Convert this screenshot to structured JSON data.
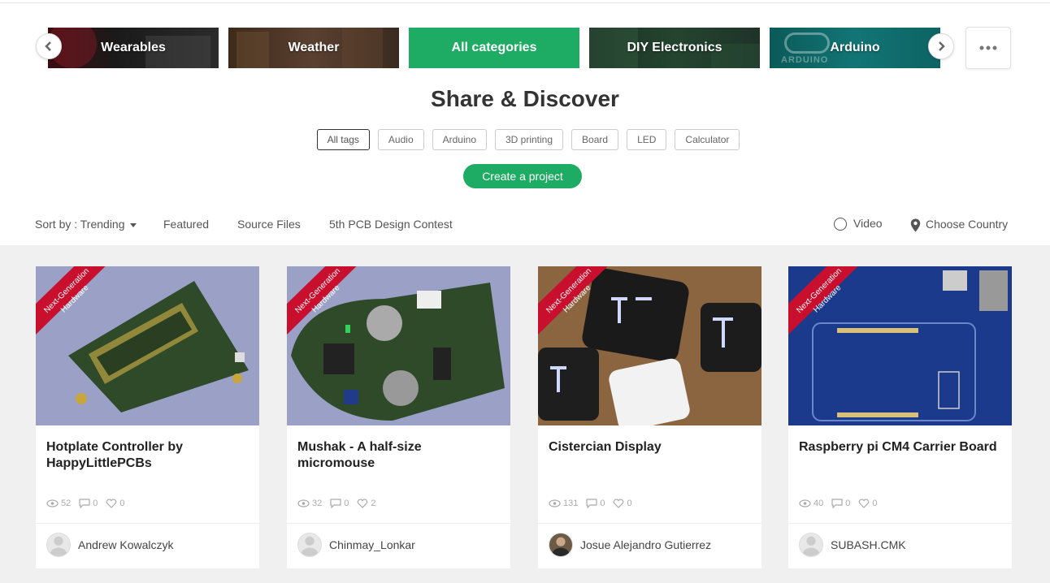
{
  "categories": [
    {
      "label": "Wearables"
    },
    {
      "label": "Weather"
    },
    {
      "label": "All categories"
    },
    {
      "label": "DIY Electronics"
    },
    {
      "label": "Arduino"
    }
  ],
  "arduino_logo_text": "ARDUINO",
  "colors": {
    "accent": "#1eab63",
    "ribbon": "#c8102e",
    "grid_bg": "#f0f0f0"
  },
  "icons": {
    "prev": "chevron-left-icon",
    "next": "chevron-right-icon",
    "more": "more-horizontal-icon"
  },
  "page": {
    "title": "Share & Discover"
  },
  "tags": [
    "All tags",
    "Audio",
    "Arduino",
    "3D printing",
    "Board",
    "LED",
    "Calculator"
  ],
  "create_button": "Create a project",
  "sortbar": {
    "sort_label": "Sort by : Trending",
    "filters": [
      "Featured",
      "Source Files",
      "5th PCB Design Contest"
    ],
    "video_label": "Video",
    "country_label": "Choose Country"
  },
  "ribbon_text": {
    "line1": "Next-Generation",
    "line2": "Hardware"
  },
  "projects": [
    {
      "title": "Hotplate Controller by HappyLittlePCBs",
      "views": "52",
      "comments": "0",
      "likes": "0",
      "author": "Andrew Kowalczyk"
    },
    {
      "title": "Mushak - A half-size micromouse",
      "views": "32",
      "comments": "0",
      "likes": "2",
      "author": "Chinmay_Lonkar"
    },
    {
      "title": "Cistercian Display",
      "views": "131",
      "comments": "0",
      "likes": "0",
      "author": "Josue Alejandro Gutierrez"
    },
    {
      "title": "Raspberry pi CM4 Carrier Board",
      "views": "40",
      "comments": "0",
      "likes": "0",
      "author": "SUBASH.CMK"
    }
  ]
}
